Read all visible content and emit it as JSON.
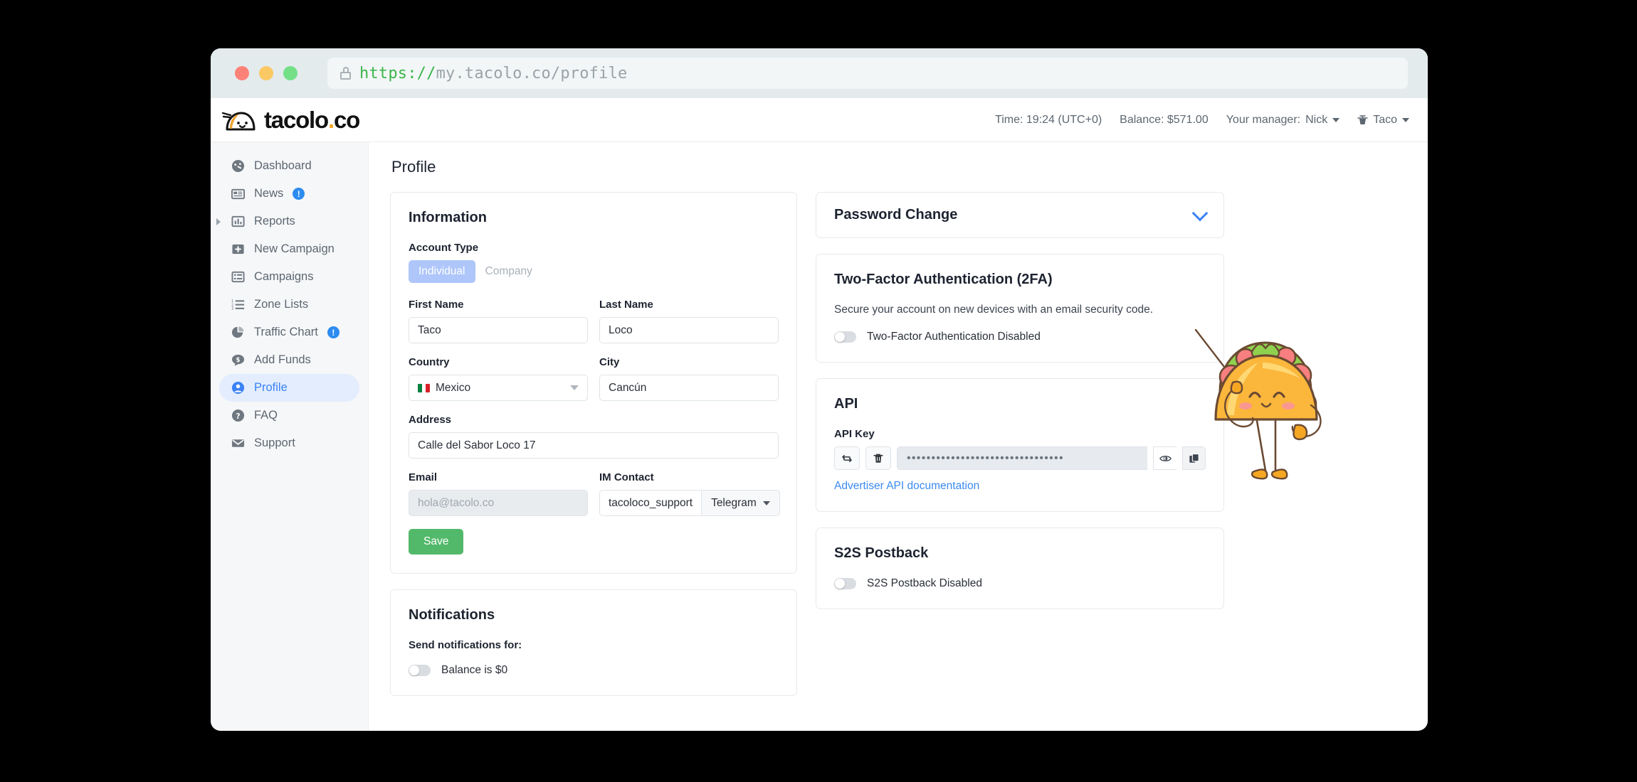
{
  "browser": {
    "url_scheme": "https://",
    "url_rest": "my.tacolo.co/profile",
    "lock_icon": "lock-icon"
  },
  "header": {
    "logo_text_main": "tacolo",
    "logo_dot": ".",
    "logo_text_suffix": "co",
    "time": "Time: 19:24 (UTC+0)",
    "balance": "Balance: $571.00",
    "manager_label": "Your manager:",
    "manager_name": "Nick",
    "user_name": "Taco"
  },
  "sidebar": {
    "items": [
      {
        "label": "Dashboard",
        "icon": "speedometer-icon",
        "badge": null,
        "active": false,
        "expandable": false
      },
      {
        "label": "News",
        "icon": "newspaper-icon",
        "badge": "!",
        "active": false,
        "expandable": false
      },
      {
        "label": "Reports",
        "icon": "bar-chart-icon",
        "badge": null,
        "active": false,
        "expandable": true
      },
      {
        "label": "New Campaign",
        "icon": "plus-square-icon",
        "badge": null,
        "active": false,
        "expandable": false
      },
      {
        "label": "Campaigns",
        "icon": "list-square-icon",
        "badge": null,
        "active": false,
        "expandable": false
      },
      {
        "label": "Zone Lists",
        "icon": "ordered-list-icon",
        "badge": null,
        "active": false,
        "expandable": false
      },
      {
        "label": "Traffic Chart",
        "icon": "pie-chart-icon",
        "badge": "!",
        "active": false,
        "expandable": false
      },
      {
        "label": "Add Funds",
        "icon": "money-bubble-icon",
        "badge": null,
        "active": false,
        "expandable": false
      },
      {
        "label": "Profile",
        "icon": "user-circle-icon",
        "badge": null,
        "active": true,
        "expandable": false
      },
      {
        "label": "FAQ",
        "icon": "question-circle-icon",
        "badge": null,
        "active": false,
        "expandable": false
      },
      {
        "label": "Support",
        "icon": "envelope-icon",
        "badge": null,
        "active": false,
        "expandable": false
      }
    ]
  },
  "page": {
    "title": "Profile"
  },
  "information": {
    "title": "Information",
    "account_type_label": "Account Type",
    "account_type_options": [
      "Individual",
      "Company"
    ],
    "account_type_selected": "Individual",
    "first_name_label": "First Name",
    "first_name_value": "Taco",
    "last_name_label": "Last Name",
    "last_name_value": "Loco",
    "country_label": "Country",
    "country_value": "Mexico",
    "city_label": "City",
    "city_value": "Cancún",
    "address_label": "Address",
    "address_value": "Calle del Sabor Loco 17",
    "email_label": "Email",
    "email_value": "hola@tacolo.co",
    "im_label": "IM Contact",
    "im_value": "tacoloco_support",
    "im_network": "Telegram",
    "save_label": "Save"
  },
  "notifications": {
    "title": "Notifications",
    "subtitle": "Send notifications for:",
    "items": [
      {
        "label": "Balance is $0",
        "enabled": false
      }
    ]
  },
  "password_change": {
    "title": "Password Change",
    "expand_icon": "chevron-down-icon"
  },
  "two_factor": {
    "title": "Two-Factor Authentication (2FA)",
    "description": "Secure your account on new devices with an email security code.",
    "toggle_label": "Two-Factor Authentication Disabled",
    "enabled": false
  },
  "api": {
    "title": "API",
    "key_label": "API Key",
    "key_masked": "••••••••••••••••••••••••••••••••",
    "regenerate_icon": "refresh-icon",
    "delete_icon": "trash-icon",
    "show_icon": "eye-icon",
    "copy_icon": "copy-icon",
    "doc_link": "Advertiser API documentation"
  },
  "s2s": {
    "title": "S2S Postback",
    "toggle_label": "S2S Postback Disabled",
    "enabled": false
  },
  "colors": {
    "accent": "#3b82f6",
    "save_green": "#53b96a",
    "badge_blue": "#2d8cf0",
    "sidebar_bg": "#f6f7f9",
    "taco_yellow": "#fbb73c"
  }
}
